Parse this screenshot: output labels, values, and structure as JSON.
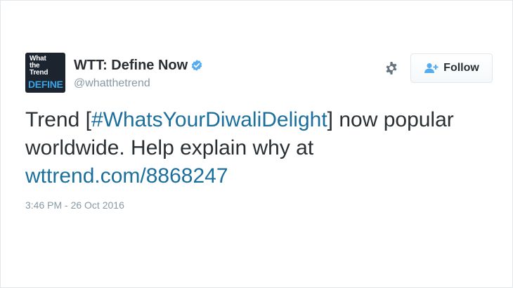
{
  "author": {
    "avatar": {
      "line1": "What",
      "line2": "the",
      "line3": "Trend",
      "line4": "DEFINE"
    },
    "display_name": "WTT: Define Now",
    "handle": "@whatthetrend",
    "verified_icon": "verified-badge-icon"
  },
  "actions": {
    "settings_icon": "gear-icon",
    "follow_icon": "add-user-icon",
    "follow_label": "Follow"
  },
  "tweet": {
    "text_prefix": "Trend [",
    "hashtag": "#WhatsYourDiwaliDelight",
    "text_middle": "] now popular worldwide. Help explain why at ",
    "link": "wttrend.com/8868247",
    "timestamp": "3:46 PM - 26 Oct 2016"
  },
  "colors": {
    "link": "#1b6f9c",
    "verified": "#55acee",
    "text": "#292f33",
    "muted": "#8899a6"
  }
}
